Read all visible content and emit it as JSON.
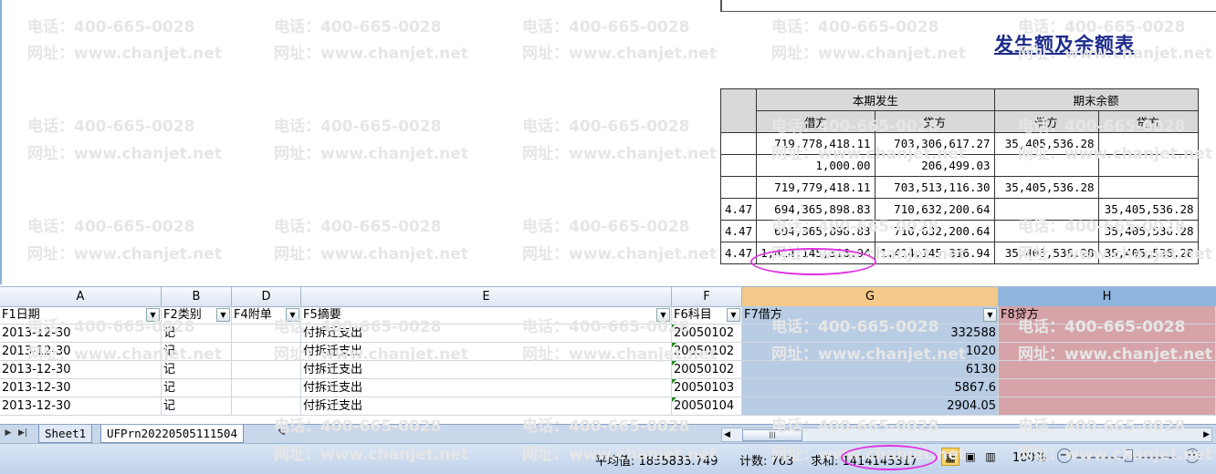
{
  "watermark": {
    "phone": "电话：400-665-0028",
    "site": "网址：www.chanjet.net"
  },
  "report": {
    "title": "发生额及余额表",
    "group_current": "本期发生",
    "group_end": "期末余额",
    "col_debit": "借方",
    "col_credit": "贷方",
    "rows": [
      {
        "stub": "",
        "cur_debit": "719,778,418.11",
        "cur_credit": "703,306,617.27",
        "end_debit": "35,405,536.28",
        "end_credit": ""
      },
      {
        "stub": "",
        "cur_debit": "1,000.00",
        "cur_credit": "206,499.03",
        "end_debit": "",
        "end_credit": ""
      },
      {
        "stub": "",
        "cur_debit": "719,779,418.11",
        "cur_credit": "703,513,116.30",
        "end_debit": "35,405,536.28",
        "end_credit": ""
      },
      {
        "stub": "4.47",
        "cur_debit": "694,365,898.83",
        "cur_credit": "710,632,200.64",
        "end_debit": "",
        "end_credit": "35,405,536.28"
      },
      {
        "stub": "4.47",
        "cur_debit": "694,365,898.83",
        "cur_credit": "710,632,200.64",
        "end_debit": "",
        "end_credit": "35,405,536.28"
      },
      {
        "stub": "4.47",
        "cur_debit": "1,414,145,316.94",
        "cur_credit": "1,414,145,316.94",
        "end_debit": "35,405,536.28",
        "end_credit": "35,405,536.28"
      }
    ]
  },
  "sheet": {
    "columns": [
      "A",
      "B",
      "D",
      "E",
      "F",
      "G",
      "H"
    ],
    "headers": [
      "F1日期",
      "F2类别",
      "F4附单",
      "F5摘要",
      "F6科目",
      "F7借方",
      "F8贷方"
    ],
    "rows": [
      {
        "date": "2013-12-30",
        "type": "记",
        "att": "",
        "summary": "付拆迁支出",
        "account": "20050102",
        "debit": "332588",
        "credit": ""
      },
      {
        "date": "2013-12-30",
        "type": "记",
        "att": "",
        "summary": "付拆迁支出",
        "account": "20050102",
        "debit": "1020",
        "credit": ""
      },
      {
        "date": "2013-12-30",
        "type": "记",
        "att": "",
        "summary": "付拆迁支出",
        "account": "20050102",
        "debit": "6130",
        "credit": ""
      },
      {
        "date": "2013-12-30",
        "type": "记",
        "att": "",
        "summary": "付拆迁支出",
        "account": "20050103",
        "debit": "5867.6",
        "credit": ""
      },
      {
        "date": "2013-12-30",
        "type": "记",
        "att": "",
        "summary": "付拆迁支出",
        "account": "20050104",
        "debit": "2904.05",
        "credit": ""
      }
    ]
  },
  "tabs": {
    "sheet1": "Sheet1",
    "sheet2": "UFPrn20220505111504"
  },
  "status": {
    "average": "平均值: 1855833.749",
    "count": "计数: 763",
    "sum": "求和: 1414145317",
    "zoom": "100%"
  },
  "colors": {
    "highlight_circle": "#e032e0",
    "title_blue": "#1b2a8a",
    "col_g_fill": "#b8cce4",
    "col_h_fill": "#d6a3a8"
  }
}
